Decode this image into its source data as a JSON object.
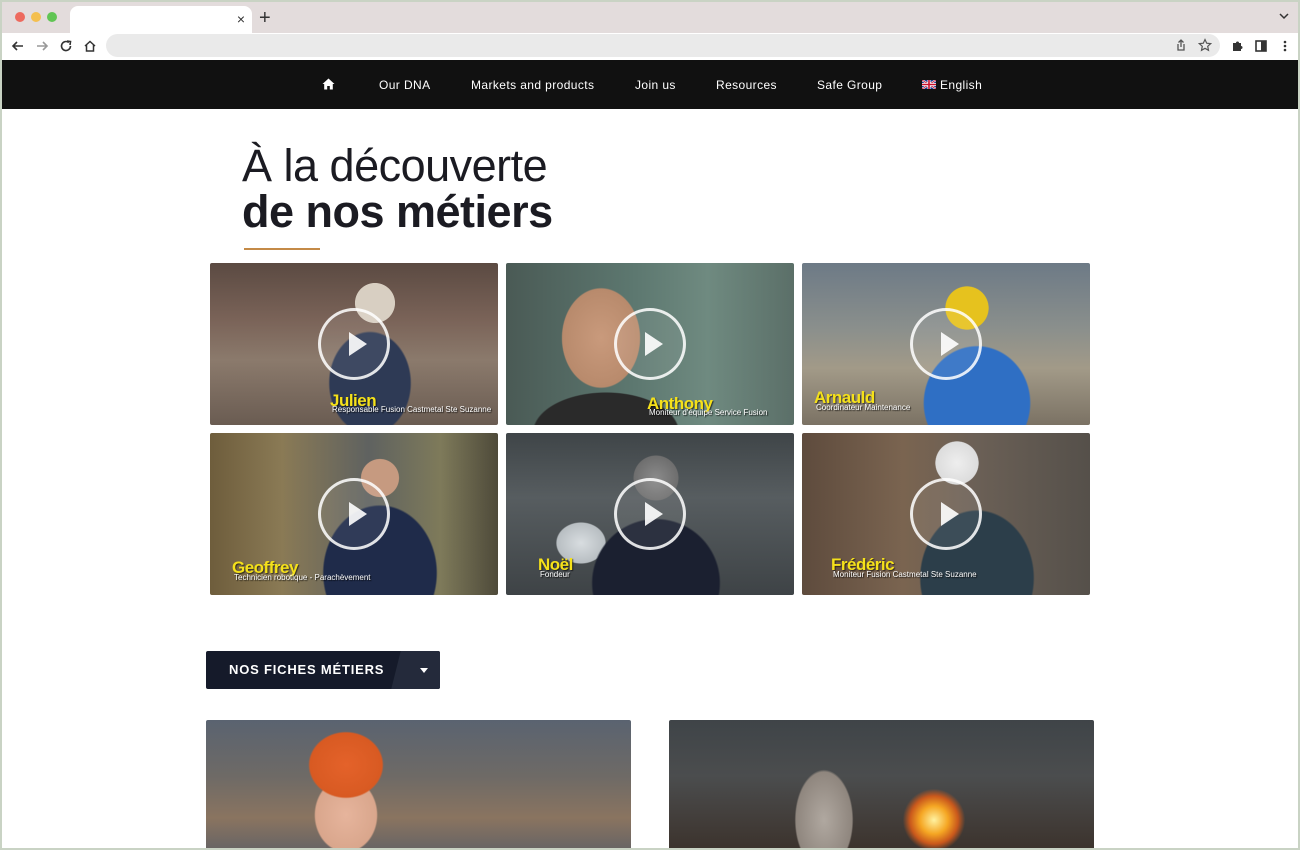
{
  "browser": {
    "tab_title": "",
    "tab_close": "×",
    "new_tab": "+",
    "url": ""
  },
  "nav": {
    "home_icon": "home-icon",
    "items": [
      "Our DNA",
      "Markets and products",
      "Join us",
      "Resources",
      "Safe Group"
    ],
    "language": "English",
    "language_flag": "uk-flag-icon"
  },
  "hero": {
    "title_light": "À la découverte",
    "title_bold": "de nos métiers",
    "accent_color": "#c48a47"
  },
  "videos": [
    {
      "name": "Julien",
      "role": "Responsable Fusion Castmetal Ste Suzanne"
    },
    {
      "name": "Anthony",
      "role": "Moniteur d'équipe Service Fusion"
    },
    {
      "name": "Arnauld",
      "role": "Coordinateur Maintenance"
    },
    {
      "name": "Geoffrey",
      "role": "Technicien robotique - Parachèvement"
    },
    {
      "name": "Noël",
      "role": "Fondeur"
    },
    {
      "name": "Frédéric",
      "role": "Moniteur Fusion Castmetal Ste Suzanne"
    }
  ],
  "fiches": {
    "label": "NOS FICHES MÉTIERS",
    "button_color": "#151a2a"
  }
}
